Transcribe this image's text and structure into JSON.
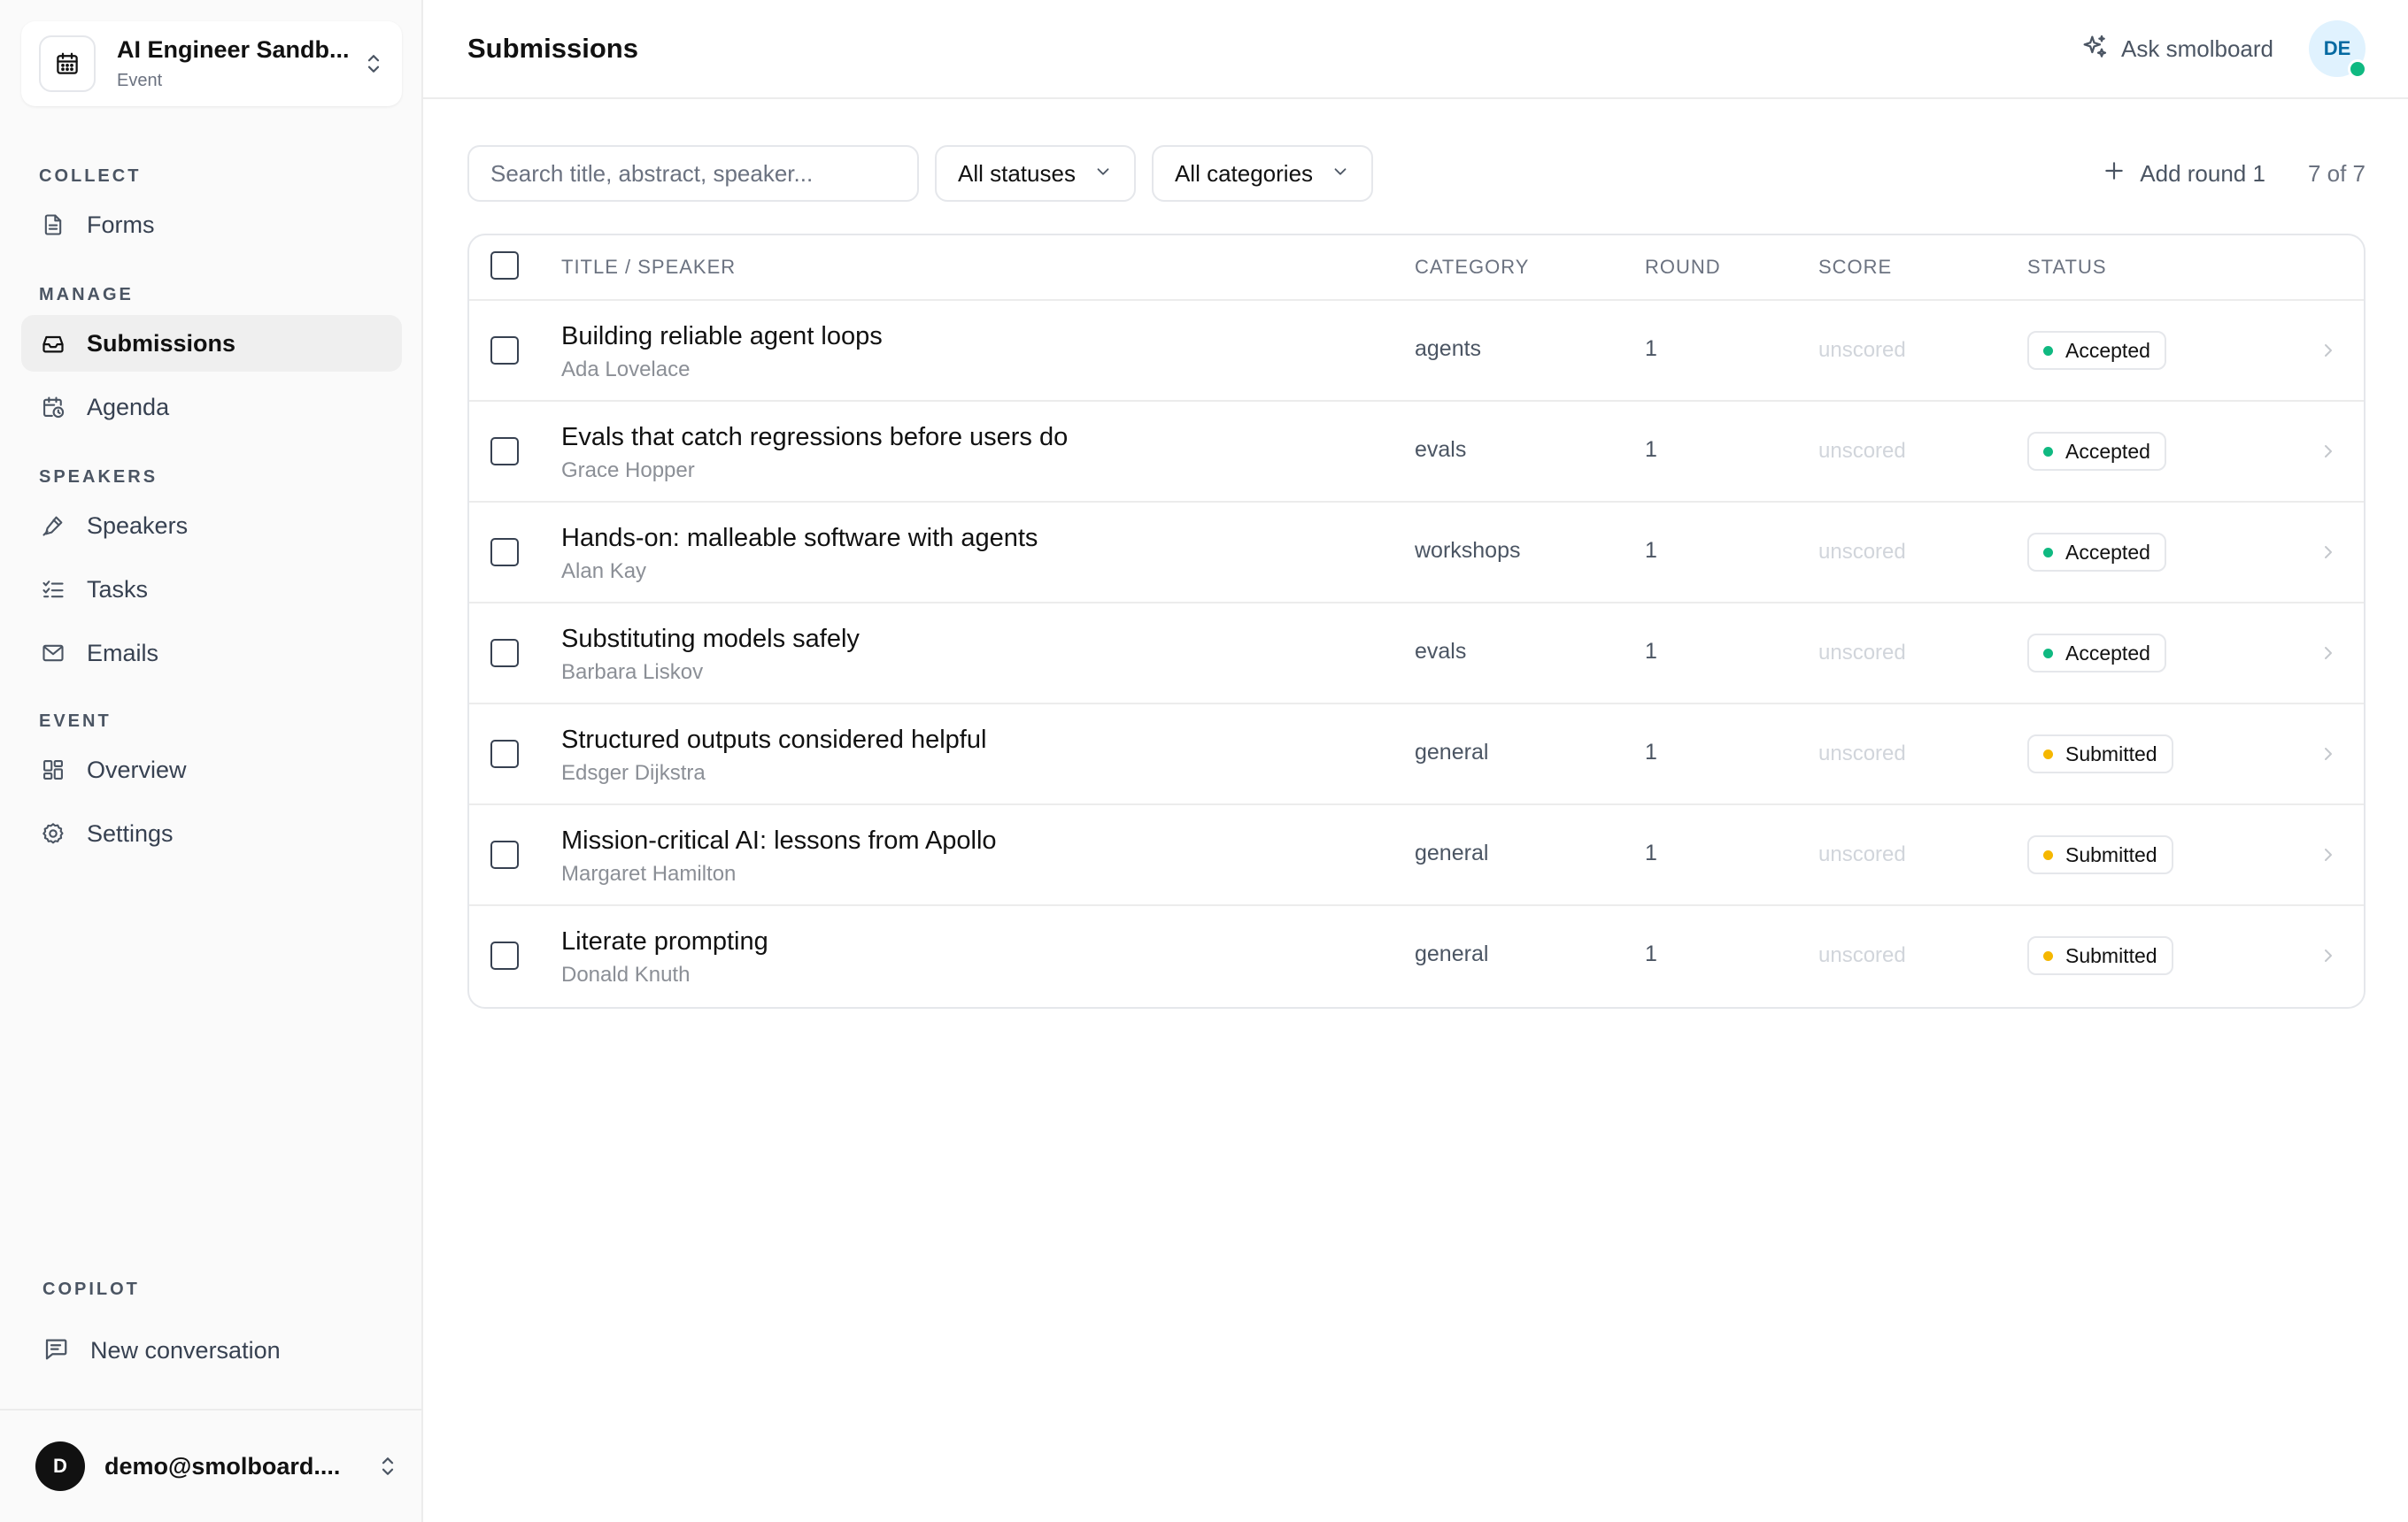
{
  "workspace": {
    "title": "AI Engineer Sandb...",
    "subtitle": "Event"
  },
  "sidebar": {
    "sections": {
      "collect": "COLLECT",
      "manage": "MANAGE",
      "speakers": "SPEAKERS",
      "event": "EVENT",
      "copilot": "COPILOT"
    },
    "items": {
      "forms": "Forms",
      "submissions": "Submissions",
      "agenda": "Agenda",
      "speakers": "Speakers",
      "tasks": "Tasks",
      "emails": "Emails",
      "overview": "Overview",
      "settings": "Settings"
    },
    "active": "submissions",
    "new_conversation": "New conversation",
    "user": {
      "initial": "D",
      "email": "demo@smolboard...."
    }
  },
  "header": {
    "title": "Submissions",
    "ask_label": "Ask smolboard",
    "avatar_initials": "DE"
  },
  "filters": {
    "search_placeholder": "Search title, abstract, speaker...",
    "status_select": "All statuses",
    "category_select": "All categories",
    "add_round": "Add round 1",
    "count": "7 of 7"
  },
  "table": {
    "columns": {
      "title": "TITLE / SPEAKER",
      "category": "CATEGORY",
      "round": "ROUND",
      "score": "SCORE",
      "status": "STATUS"
    },
    "rows": [
      {
        "title": "Building reliable agent loops",
        "speaker": "Ada Lovelace",
        "category": "agents",
        "round": "1",
        "score": "unscored",
        "status": "Accepted"
      },
      {
        "title": "Evals that catch regressions before users do",
        "speaker": "Grace Hopper",
        "category": "evals",
        "round": "1",
        "score": "unscored",
        "status": "Accepted"
      },
      {
        "title": "Hands-on: malleable software with agents",
        "speaker": "Alan Kay",
        "category": "workshops",
        "round": "1",
        "score": "unscored",
        "status": "Accepted"
      },
      {
        "title": "Substituting models safely",
        "speaker": "Barbara Liskov",
        "category": "evals",
        "round": "1",
        "score": "unscored",
        "status": "Accepted"
      },
      {
        "title": "Structured outputs considered helpful",
        "speaker": "Edsger Dijkstra",
        "category": "general",
        "round": "1",
        "score": "unscored",
        "status": "Submitted"
      },
      {
        "title": "Mission-critical AI: lessons from Apollo",
        "speaker": "Margaret Hamilton",
        "category": "general",
        "round": "1",
        "score": "unscored",
        "status": "Submitted"
      },
      {
        "title": "Literate prompting",
        "speaker": "Donald Knuth",
        "category": "general",
        "round": "1",
        "score": "unscored",
        "status": "Submitted"
      }
    ]
  },
  "colors": {
    "accepted": "#10b981",
    "submitted": "#f5b700",
    "online": "#10b981"
  }
}
